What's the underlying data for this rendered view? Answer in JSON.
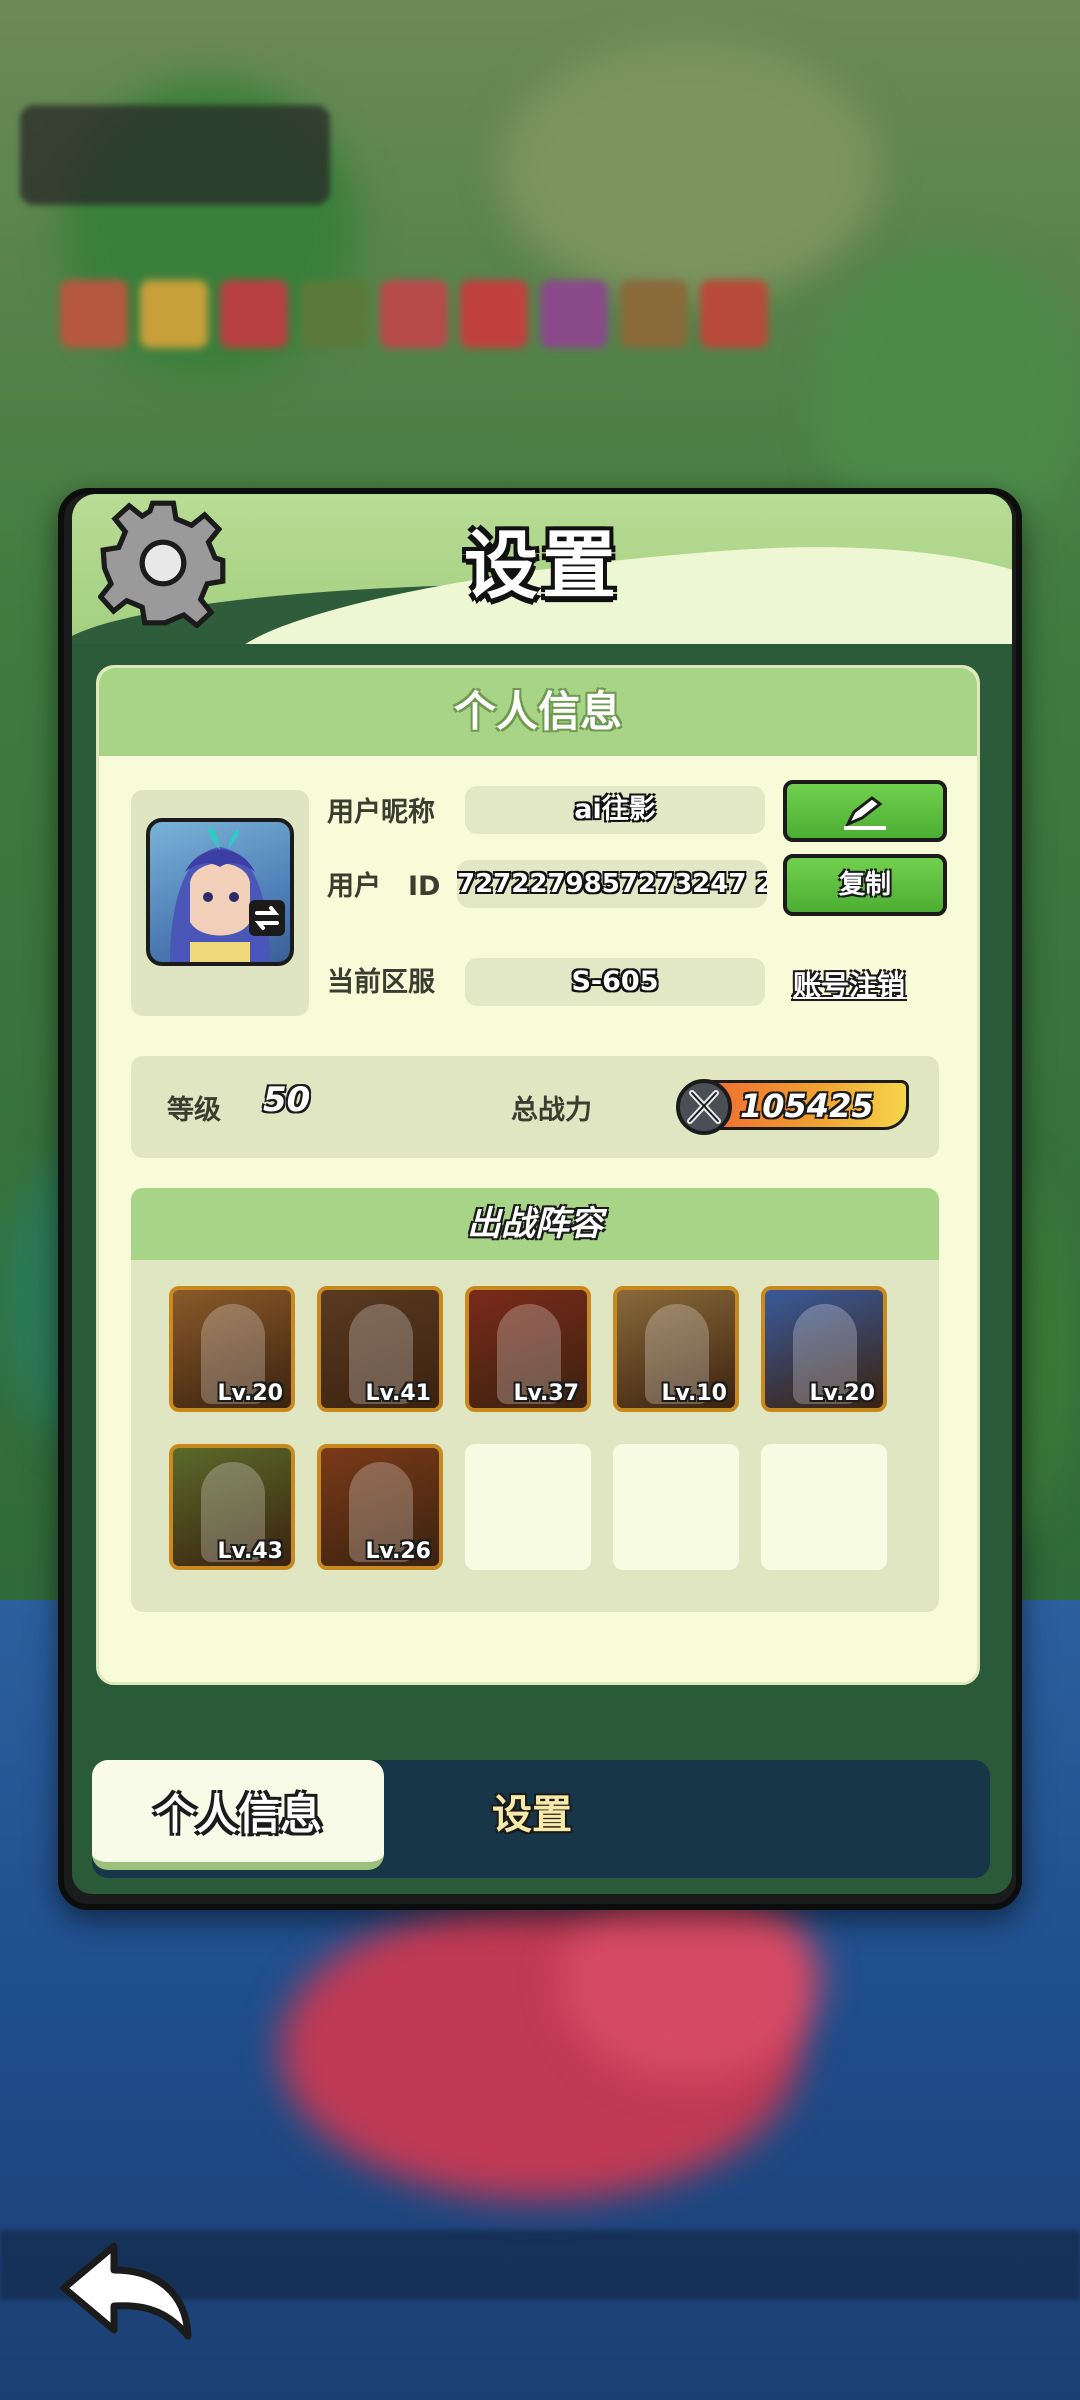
{
  "dialog": {
    "title": "设置",
    "icon": "gear-icon"
  },
  "profile": {
    "section_title": "个人信息",
    "nickname_label": "用户昵称",
    "nickname": "ai往影",
    "edit_icon": "pencil-icon",
    "id_label": "用户　ID",
    "user_id": "7272279857273247 2",
    "copy_label": "复制",
    "server_label": "当前区服",
    "server": "S-605",
    "cancel_account_label": "账号注销"
  },
  "stats": {
    "level_label": "等级",
    "level": "50",
    "power_label": "总战力",
    "power": "105425"
  },
  "team": {
    "title": "出战阵容",
    "heroes": [
      {
        "level": "Lv.20",
        "color": "#8a5a2a"
      },
      {
        "level": "Lv.41",
        "color": "#5a3a22"
      },
      {
        "level": "Lv.37",
        "color": "#7a2a1a"
      },
      {
        "level": "Lv.10",
        "color": "#8a6a3a"
      },
      {
        "level": "Lv.20",
        "color": "#3a5a9a"
      },
      {
        "level": "Lv.43",
        "color": "#5a6a2a"
      },
      {
        "level": "Lv.26",
        "color": "#7a3a18"
      }
    ],
    "empty_slots": 3
  },
  "tabs": {
    "active": "个人信息",
    "settings": "设置"
  },
  "nav": {
    "back_icon": "back-arrow-icon"
  }
}
